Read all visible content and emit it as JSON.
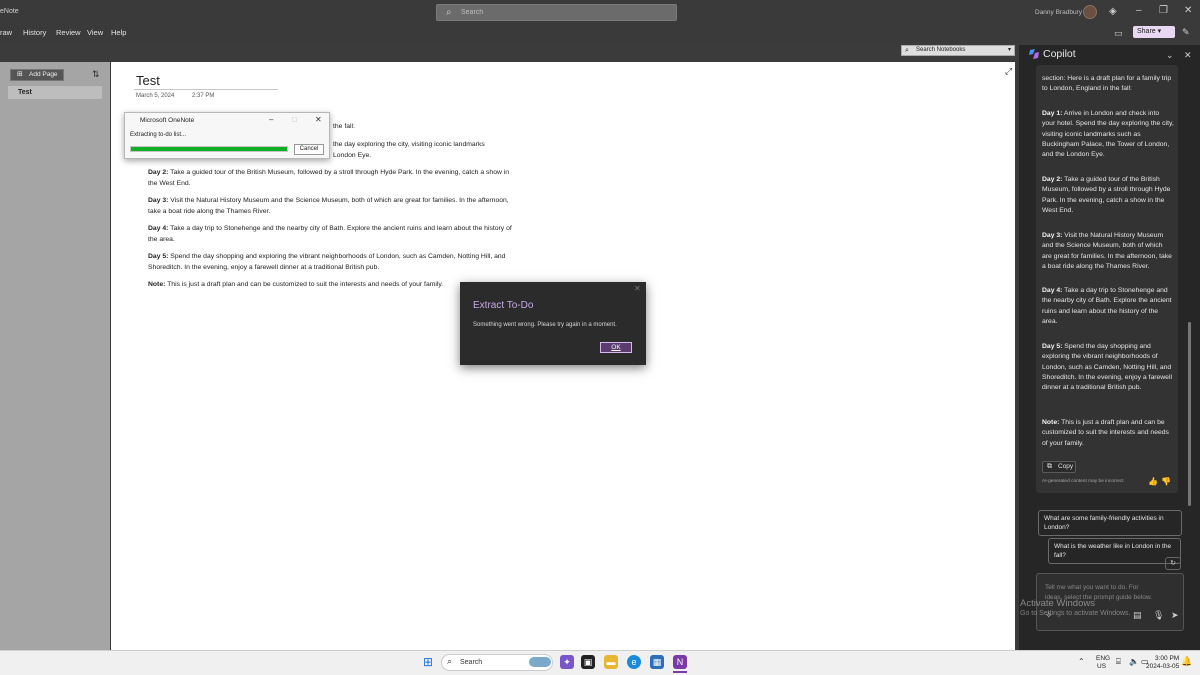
{
  "titlebar": {
    "app_title": "eNote",
    "search_placeholder": "Search",
    "user_name": "Danny Bradbury",
    "share_label": "Share"
  },
  "menu": [
    "raw",
    "History",
    "Review",
    "View",
    "Help"
  ],
  "notebooks_search": "Search Notebooks",
  "pages": {
    "add_page_label": "Add Page",
    "items": [
      "Test"
    ]
  },
  "page": {
    "title": "Test",
    "date": "March 5, 2024",
    "time": "2:37 PM",
    "fragment_fall": "the fall:",
    "fragment_day1_a": "the day exploring the city, visiting iconic landmarks",
    "fragment_day1_b": "London Eye.",
    "days": [
      {
        "label": "Day 2:",
        "text": " Take a guided tour of the British Museum, followed by a stroll through Hyde Park. In the evening, catch a show in the West End."
      },
      {
        "label": "Day 3:",
        "text": " Visit the Natural History Museum and the Science Museum, both of which are great for families. In the afternoon, take a boat ride along the Thames River."
      },
      {
        "label": "Day 4:",
        "text": " Take a day trip to Stonehenge and the nearby city of Bath. Explore the ancient ruins and learn about the history of the area."
      },
      {
        "label": "Day 5:",
        "text": " Spend the day shopping and exploring the vibrant neighborhoods of London, such as Camden, Notting Hill, and Shoreditch. In the evening, enjoy a farewell dinner at a traditional British pub."
      },
      {
        "label": "Note:",
        "text": " This is just a draft plan and can be customized to suit the interests and needs of your family."
      }
    ]
  },
  "progress_dialog": {
    "title": "Microsoft OneNote",
    "status": "Extracting to-do list...",
    "progress": 1.0,
    "cancel_label": "Cancel"
  },
  "error_dialog": {
    "title": "Extract To-Do",
    "message": "Something went wrong. Please try again in a moment.",
    "ok_label": "OK"
  },
  "copilot": {
    "title": "Copilot",
    "intro": "section: Here is a draft plan for a family trip to London, England in the fall:",
    "days": [
      {
        "label": "Day 1:",
        "text": " Arrive in London and check into your hotel. Spend the day exploring the city, visiting iconic landmarks such as Buckingham Palace, the Tower of London, and the London Eye."
      },
      {
        "label": "Day 2:",
        "text": " Take a guided tour of the British Museum, followed by a stroll through Hyde Park. In the evening, catch a show in the West End."
      },
      {
        "label": "Day 3:",
        "text": " Visit the Natural History Museum and the Science Museum, both of which are great for families. In the afternoon, take a boat ride along the Thames River."
      },
      {
        "label": "Day 4:",
        "text": " Take a day trip to Stonehenge and the nearby city of Bath. Explore the ancient ruins and learn about the history of the area."
      },
      {
        "label": "Day 5:",
        "text": " Spend the day shopping and exploring the vibrant neighborhoods of London, such as Camden, Notting Hill, and Shoreditch. In the evening, enjoy a farewell dinner at a traditional British pub."
      },
      {
        "label": "Note:",
        "text": " This is just a draft plan and can be customized to suit the interests and needs of your family."
      }
    ],
    "copy_label": "Copy",
    "disclaimer": "AI-generated content may be incorrect",
    "suggestions": [
      "What are some family-friendly activities in London?",
      "What is the weather like in London in the fall?"
    ],
    "input_placeholder": "Tell me what you want to do. For ideas, select the prompt guide below.",
    "activate_title": "Activate Windows",
    "activate_sub": "Go to Settings to activate Windows."
  },
  "taskbar": {
    "search_label": "Search",
    "lang_top": "ENG",
    "lang_bottom": "US",
    "time": "3:00 PM",
    "date": "2024-03-05"
  },
  "colors": {
    "progress": "#10b026",
    "accent": "#c9a7e6",
    "copilot_bg": "#262626"
  }
}
